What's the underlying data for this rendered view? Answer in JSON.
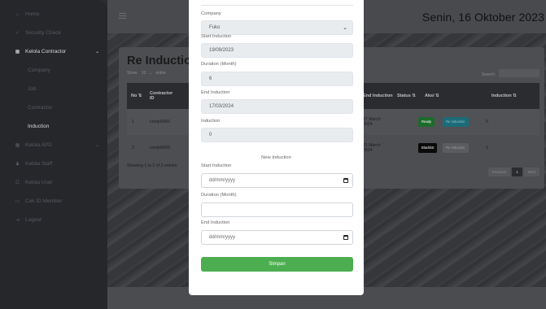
{
  "header": {
    "date": "Senin, 16 Oktober 2023"
  },
  "sidebar": {
    "items": [
      {
        "label": "Home",
        "icon": "home-icon"
      },
      {
        "label": "Security Check",
        "icon": "check-icon"
      },
      {
        "label": "Kelola Contractor",
        "icon": "list-icon"
      },
      {
        "label": "Company"
      },
      {
        "label": "Job"
      },
      {
        "label": "Contractor"
      },
      {
        "label": "Induction"
      },
      {
        "label": "Kelola APD",
        "icon": "list-icon"
      },
      {
        "label": "Kelola Staff",
        "icon": "user-icon"
      },
      {
        "label": "Kelola User",
        "icon": "users-icon"
      },
      {
        "label": "Cek ID Member",
        "icon": "id-icon"
      },
      {
        "label": "Logout",
        "icon": "logout-icon"
      }
    ]
  },
  "card": {
    "title": "Re Inductic",
    "show_label": "Show",
    "show_value": "10",
    "entries_word": "entrie",
    "search_label": "Search:",
    "columns": [
      "No",
      "Contractor ID",
      "End Induction",
      "Status",
      "Aksi",
      "Induction"
    ],
    "rows": [
      {
        "no": "1",
        "contractor_id": "contpi0001",
        "end_frag": "ber",
        "end_induction": "17 March 2024",
        "status": "Ready",
        "aksi": "Re Induction",
        "induction": "0"
      },
      {
        "no": "2",
        "contractor_id": "contpi0002",
        "end_frag": "ber",
        "end_induction": "21 March 2024",
        "status": "Blacklist",
        "aksi": "Re Induction",
        "induction": "1"
      }
    ],
    "entries_info": "Showing 1 to 2 of 2 entries",
    "pager": {
      "prev": "Previous",
      "page": "1",
      "next": "Next"
    }
  },
  "modal": {
    "company_label": "Company",
    "company_value": "Fuko",
    "start_label": "Start Induction",
    "start_value": "19/09/2023",
    "duration_label": "Duration (Month)",
    "duration_value": "6",
    "end_label": "End Induction",
    "end_value": "17/03/2024",
    "induction_label": "Induction",
    "induction_value": "0",
    "new_section": "New Induction",
    "new_start_label": "Start Induction",
    "new_start_placeholder": "dd/mm/yyyy",
    "new_duration_label": "Duration (Month)",
    "new_end_label": "End Induction",
    "new_end_placeholder": "dd/mm/yyyy",
    "save_label": "Simpan"
  },
  "colors": {
    "save": "#4cae50",
    "ready": "#1d6b2a",
    "blacklist": "#0a0a0a",
    "reinduction": "#1c6b78"
  }
}
